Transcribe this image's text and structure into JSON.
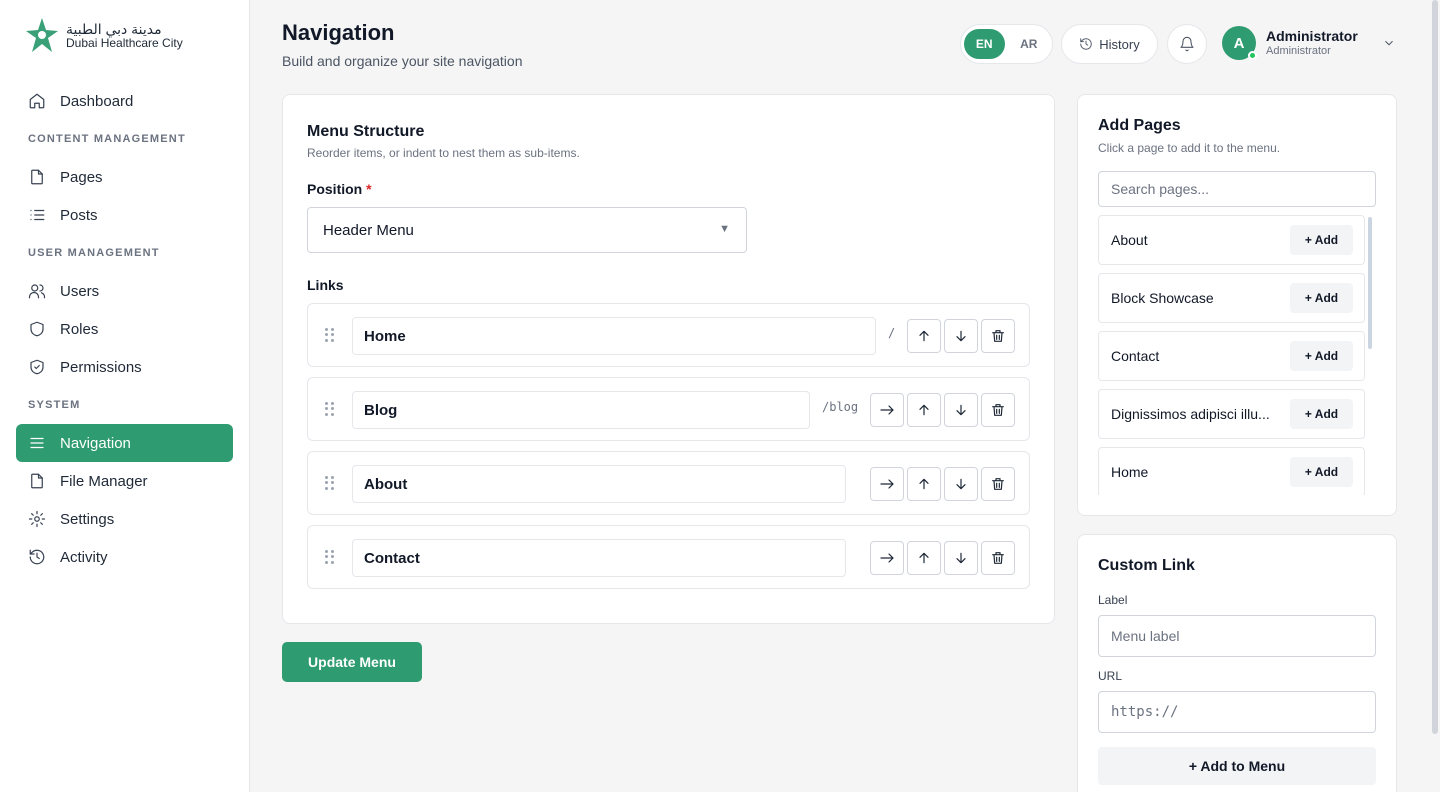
{
  "brand": {
    "name_ar": "مدينة دبي الطبية",
    "name_en": "Dubai Healthcare City",
    "accent": "#2f9b70"
  },
  "sidebar": {
    "dashboard": "Dashboard",
    "sections": {
      "content": "CONTENT MANAGEMENT",
      "users": "USER MANAGEMENT",
      "system": "SYSTEM"
    },
    "items": {
      "pages": "Pages",
      "posts": "Posts",
      "users": "Users",
      "roles": "Roles",
      "permissions": "Permissions",
      "navigation": "Navigation",
      "file_manager": "File Manager",
      "settings": "Settings",
      "activity": "Activity"
    },
    "active": "Navigation"
  },
  "header": {
    "title": "Navigation",
    "subtitle": "Build and organize your site navigation",
    "lang_en": "EN",
    "lang_ar": "AR",
    "history": "History",
    "user_name": "Administrator",
    "user_role": "Administrator",
    "avatar_initial": "A"
  },
  "menu_structure": {
    "title": "Menu Structure",
    "subtitle": "Reorder items, or indent to nest them as sub-items.",
    "position_label": "Position",
    "required_mark": "*",
    "position_value": "Header Menu",
    "links_label": "Links",
    "links": [
      {
        "label": "Home",
        "url": "/"
      },
      {
        "label": "Blog",
        "url": "/blog"
      },
      {
        "label": "About",
        "url": ""
      },
      {
        "label": "Contact",
        "url": ""
      }
    ],
    "update_button": "Update Menu"
  },
  "add_pages": {
    "title": "Add Pages",
    "subtitle": "Click a page to add it to the menu.",
    "search_placeholder": "Search pages...",
    "add_label": "+ Add",
    "pages": [
      "About",
      "Block Showcase",
      "Contact",
      "Dignissimos adipisci illu...",
      "Home"
    ]
  },
  "custom_link": {
    "title": "Custom Link",
    "label_label": "Label",
    "label_placeholder": "Menu label",
    "url_label": "URL",
    "url_placeholder": "https://",
    "add_button": "+ Add to Menu"
  }
}
